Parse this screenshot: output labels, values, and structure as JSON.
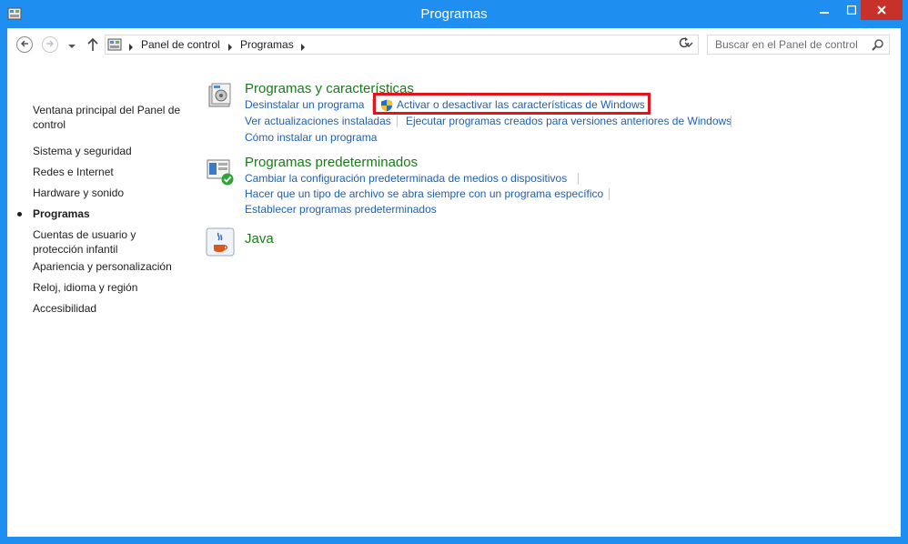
{
  "window": {
    "title": "Programas"
  },
  "navigation": {
    "breadcrumb": [
      "Panel de control",
      "Programas"
    ],
    "search_placeholder": "Buscar en el Panel de control"
  },
  "sidebar": {
    "items": [
      {
        "label": "Ventana principal del Panel de control"
      },
      {
        "label": "Sistema y seguridad"
      },
      {
        "label": "Redes e Internet"
      },
      {
        "label": "Hardware y sonido"
      },
      {
        "label": "Programas",
        "current": true
      },
      {
        "label": "Cuentas de usuario y protección infantil"
      },
      {
        "label": "Apariencia y personalización"
      },
      {
        "label": "Reloj, idioma y región"
      },
      {
        "label": "Accesibilidad"
      }
    ]
  },
  "categories": [
    {
      "title": "Programas y características",
      "links": [
        "Desinstalar un programa",
        "Activar o desactivar las características de Windows",
        "Ver actualizaciones instaladas",
        "Ejecutar programas creados para versiones anteriores de Windows",
        "Cómo instalar un programa"
      ]
    },
    {
      "title": "Programas predeterminados",
      "links": [
        "Cambiar la configuración predeterminada de medios o dispositivos",
        "Hacer que un tipo de archivo se abra siempre con un programa específico",
        "Establecer programas predeterminados"
      ]
    },
    {
      "title": "Java",
      "links": []
    }
  ],
  "colors": {
    "chrome": "#1e8ef0",
    "close_button": "#c7312a",
    "category_title": "#1a7a1a",
    "link": "#2060b4",
    "highlight_box": "#e3141c"
  },
  "icons": [
    "control-panel-icon",
    "back-arrow-icon",
    "forward-arrow-icon",
    "recent-pages-icon",
    "up-arrow-icon",
    "refresh-icon",
    "search-icon",
    "shield-icon",
    "programs-features-icon",
    "default-programs-icon",
    "java-icon"
  ]
}
